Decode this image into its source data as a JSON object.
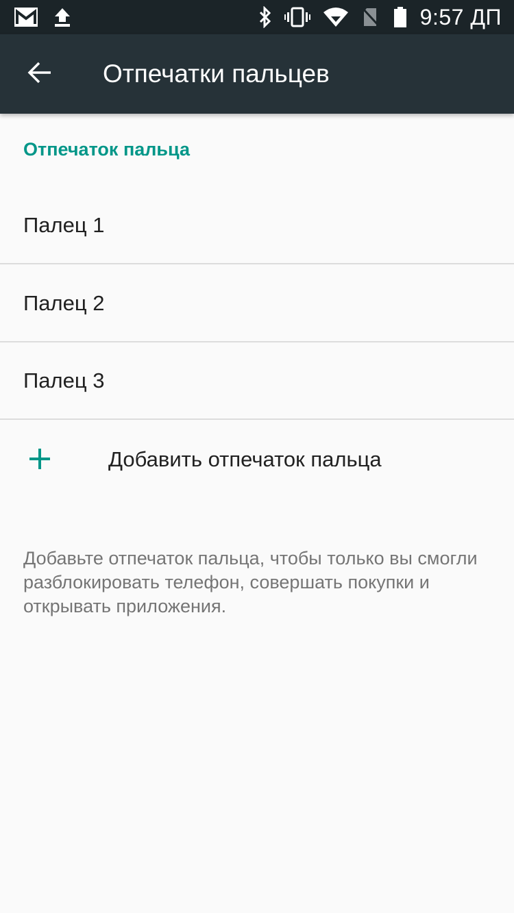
{
  "status_bar": {
    "time": "9:57 ДП",
    "left_icons": [
      "gmail-icon",
      "upload-icon"
    ],
    "right_icons": [
      "bluetooth-icon",
      "vibrate-icon",
      "wifi-icon",
      "no-sim-icon",
      "battery-icon"
    ]
  },
  "app_bar": {
    "title": "Отпечатки пальцев",
    "back_icon": "arrow-back-icon"
  },
  "section": {
    "header": "Отпечаток пальца"
  },
  "fingers": [
    {
      "label": "Палец 1"
    },
    {
      "label": "Палец 2"
    },
    {
      "label": "Палец 3"
    }
  ],
  "add_fingerprint": {
    "label": "Добавить отпечаток пальца",
    "icon": "plus-icon"
  },
  "footer": {
    "description": "Добавьте отпечаток пальца, чтобы только вы смогли разблокировать телефон, совершать покупки и открывать приложения."
  },
  "colors": {
    "accent": "#009688",
    "app_bar": "#263238",
    "status_bar": "#1b2428",
    "background": "#fafafa"
  }
}
